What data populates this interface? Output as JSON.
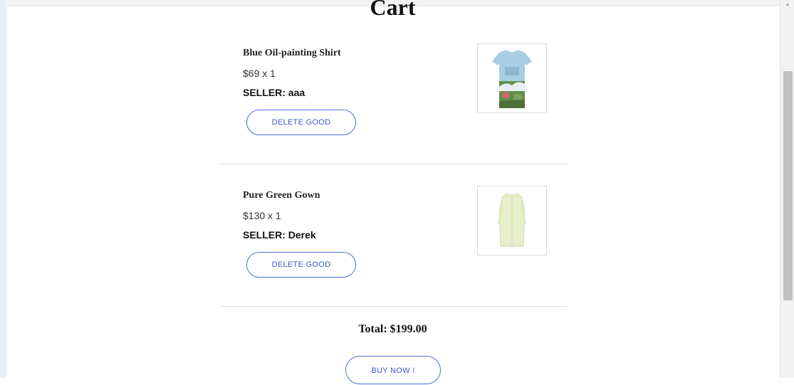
{
  "page": {
    "title": "Cart"
  },
  "items": [
    {
      "name": "Blue Oil-painting Shirt",
      "price_line": "$69 x 1",
      "seller_label": "SELLER: aaa",
      "delete_label": "DELETE GOOD",
      "image_icon": "shirt-image"
    },
    {
      "name": "Pure Green Gown",
      "price_line": "$130 x 1",
      "seller_label": "SELLER: Derek",
      "delete_label": "DELETE GOOD",
      "image_icon": "gown-image"
    }
  ],
  "summary": {
    "total_label": "Total:",
    "total_value": "$199.00",
    "buy_label": "BUY NOW !"
  },
  "colors": {
    "accent": "#3a5bc7",
    "button_border": "#4a6fd6",
    "divider": "#dddddd"
  }
}
